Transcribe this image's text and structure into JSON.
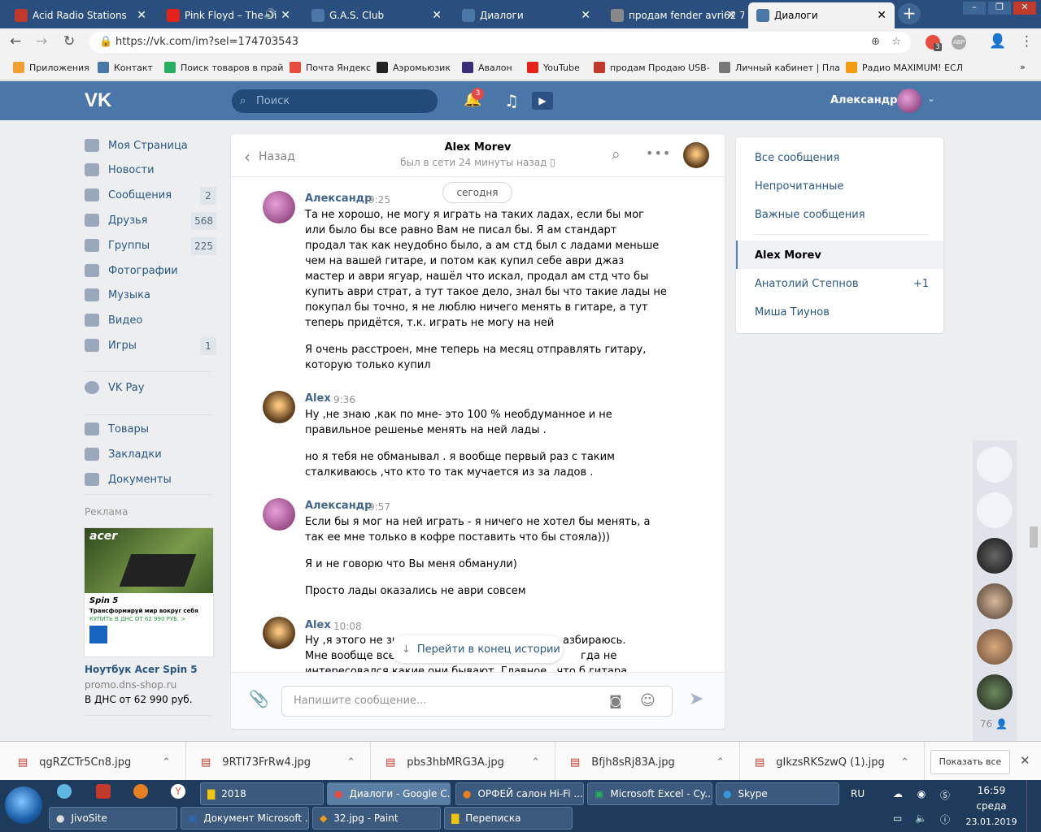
{
  "browser": {
    "tabs": [
      {
        "title": "Acid Radio Stations",
        "favicon_color": "#c0392b"
      },
      {
        "title": "Pink Floyd – The Di",
        "favicon_color": "#e62117"
      },
      {
        "title": "G.A.S. Club",
        "favicon_color": "#4a76a8"
      },
      {
        "title": "Диалоги",
        "favicon_color": "#4a76a8"
      },
      {
        "title": "продам fender avri62 7",
        "favicon_color": "#555555"
      },
      {
        "title": "Диалоги",
        "favicon_color": "#4a76a8"
      }
    ],
    "url": "https://vk.com/im?sel=174703543",
    "bookmarks": [
      "Приложения",
      "Контакт",
      "Поиск товаров в прай",
      "Почта Яндекс",
      "Аэромьюзик",
      "Авалон",
      "YouTube",
      "продам Продаю USB-",
      "Личный кабинет | Пла",
      "Радио MAXIMUM! ЕСЛ"
    ],
    "ext_badge": "3",
    "ext_label": "АВР"
  },
  "vk": {
    "logo": "VK",
    "search_placeholder": "Поиск",
    "notif_count": "3",
    "user_name": "Александр",
    "accent": "#4a76a8"
  },
  "nav": {
    "items": [
      {
        "label": "Моя Страница",
        "badge": ""
      },
      {
        "label": "Новости",
        "badge": ""
      },
      {
        "label": "Сообщения",
        "badge": "2"
      },
      {
        "label": "Друзья",
        "badge": "568"
      },
      {
        "label": "Группы",
        "badge": "225"
      },
      {
        "label": "Фотографии",
        "badge": ""
      },
      {
        "label": "Музыка",
        "badge": ""
      },
      {
        "label": "Видео",
        "badge": ""
      },
      {
        "label": "Игры",
        "badge": "1"
      },
      {
        "label": "VK Pay",
        "badge": ""
      },
      {
        "label": "Товары",
        "badge": ""
      },
      {
        "label": "Закладки",
        "badge": ""
      },
      {
        "label": "Документы",
        "badge": ""
      }
    ],
    "ads_title": "Реклама",
    "ad": {
      "brand": "acer",
      "model": "Spin 5",
      "tagline": "Трансформируй мир вокруг себя",
      "price_line": "КУПИТЬ В ДНС ОТ 62 990 РУБ. >",
      "name": "Ноутбук Acer Spin 5",
      "domain": "promo.dns-shop.ru",
      "price": "В ДНС от 62 990 руб."
    }
  },
  "chat": {
    "back_label": "Назад",
    "peer_name": "Alex Morev",
    "peer_status": "был в сети 24 минуты назад",
    "date_label": "сегодня",
    "messages": [
      {
        "author": "Александр",
        "time": "9:25",
        "text": [
          "Та не хорошо, не могу я играть на таких ладах, если бы мог",
          "или было бы все равно Вам не писал бы. Я ам стандарт",
          "продал так как неудобно было, а ам стд был с ладами меньше",
          "чем на вашей гитаре, и потом как купил себе аври джаз",
          "мастер и аври ягуар, нашёл что искал, продал ам стд что бы",
          "купить аври страт, а тут такое дело, знал бы что такие лады не",
          "покупал бы точно, я не люблю ничего менять в гитаре, а тут",
          "теперь придётся, т.к. играть не могу на ней"
        ],
        "text2": [
          "Я очень расстроен, мне теперь на месяц отправлять гитару,",
          "которую только купил"
        ]
      },
      {
        "author": "Alex",
        "time": "9:36",
        "text": [
          "Ну ,не знаю ,как по мне- это 100 % необдуманное и не",
          "правильное решенье менять на ней лады ."
        ],
        "text2": [
          "но я тебя не обманывал . я вообще первый раз с таким",
          "сталкиваюсь ,что кто то так мучается из за ладов ."
        ]
      },
      {
        "author": "Александр",
        "time": "9:57",
        "text": [
          "Если бы я мог на ней играть - я ничего не хотел бы менять, а",
          "так ее мне только в кофре поставить что бы стояла)))"
        ],
        "text2": [
          "Я и не говорю что Вы меня обманули)"
        ],
        "text3": [
          "Просто лады оказались не аври совсем"
        ]
      },
      {
        "author": "Alex",
        "time": "10:08",
        "text": [
          "Ну ,я этого не зн",
          "Мне вообще все",
          "интересовался какие они бывают. Главное , что б гитара"
        ],
        "text_right": [
          "азбираюсь.",
          "гда не"
        ]
      }
    ],
    "jump_label": "Перейти в конец истории",
    "input_placeholder": "Напишите сообщение..."
  },
  "dialogs": {
    "links": [
      "Все сообщения",
      "Непрочитанные",
      "Важные сообщения"
    ],
    "conversations": [
      {
        "name": "Alex Morev",
        "badge": "",
        "active": true
      },
      {
        "name": "Анатолий Степнов",
        "badge": "+1",
        "active": false
      },
      {
        "name": "Миша Тиунов",
        "badge": "",
        "active": false
      }
    ]
  },
  "online_count": "76",
  "downloads": {
    "files": [
      "qgRZCTr5Cn8.jpg",
      "9RTI73FrRw4.jpg",
      "pbs3hbMRG3A.jpg",
      "Bfjh8sRj83A.jpg",
      "gIkzsRKSzwQ (1).jpg"
    ],
    "show_all": "Показать все"
  },
  "taskbar": {
    "row1": [
      "2018",
      "Диалоги - Google C...",
      "ОРФЕЙ салон Hi-Fi ...",
      "Microsoft Excel - Cy...",
      "Skype"
    ],
    "row2": [
      "JivoSite",
      "Документ Microsoft ...",
      "32.jpg - Paint",
      "Переписка"
    ],
    "lang": "RU",
    "clock_time": "16:59",
    "clock_day": "среда",
    "clock_date": "23.01.2019"
  }
}
